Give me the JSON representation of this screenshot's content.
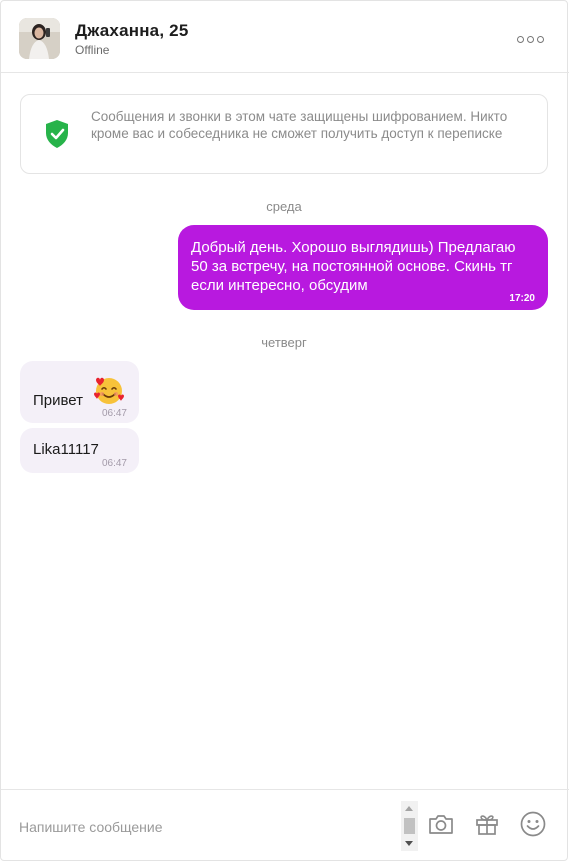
{
  "header": {
    "name": "Джаханна, 25",
    "status": "Offline"
  },
  "notice": {
    "text": "Сообщения и звонки в этом чате защищены шифрованием. Никто кроме вас и собеседника не сможет получить доступ к переписке"
  },
  "days": [
    "среда",
    "четверг"
  ],
  "messages": {
    "out1": {
      "text": "Добрый день. Хорошо выглядишь) Предлагаю 50 за встречу, на постоянной основе. Скинь тг если интересно, обсудим",
      "time": "17:20"
    },
    "in1": {
      "text": "Привет",
      "time": "06:47"
    },
    "in2": {
      "text": "Lika11117",
      "time": "06:47"
    }
  },
  "composer": {
    "placeholder": "Напишите сообщение"
  },
  "colors": {
    "outgoing_bubble": "#b819df",
    "incoming_bubble": "#f4f0f8",
    "shield": "#27b34a"
  }
}
